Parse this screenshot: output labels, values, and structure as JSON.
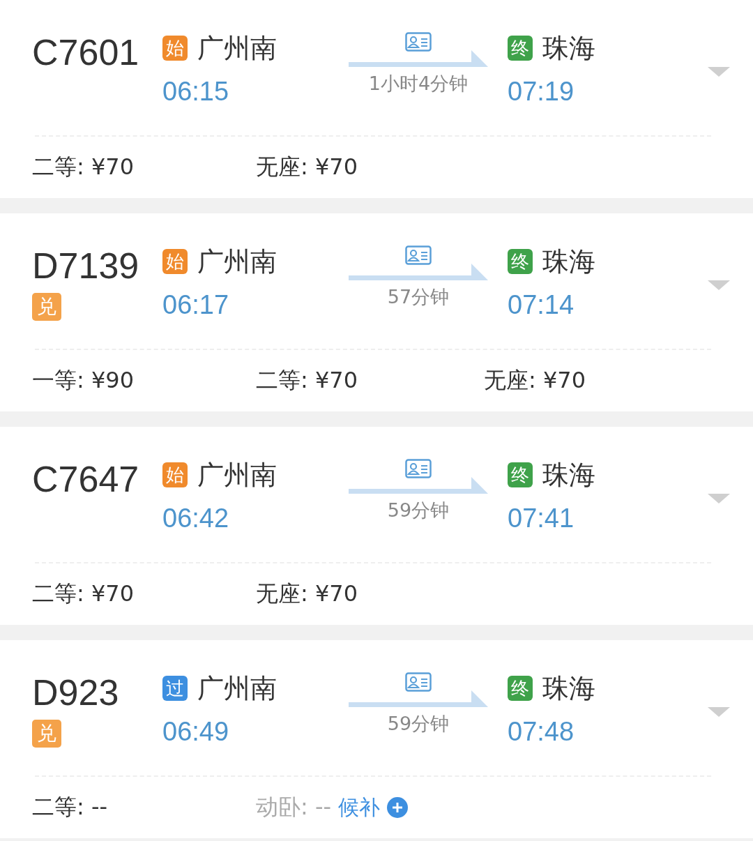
{
  "trains": [
    {
      "number": "C7601",
      "from": {
        "badge": "始",
        "kind": "start",
        "station": "广州南",
        "time": "06:15"
      },
      "duration": "1小时4分钟",
      "to": {
        "badge": "终",
        "kind": "end",
        "station": "珠海",
        "time": "07:19"
      },
      "seats": [
        {
          "label": "二等: ¥70",
          "disabled": false
        },
        {
          "label": "无座: ¥70",
          "disabled": false
        }
      ]
    },
    {
      "number": "D7139",
      "exchange": "兑",
      "from": {
        "badge": "始",
        "kind": "start",
        "station": "广州南",
        "time": "06:17"
      },
      "duration": "57分钟",
      "to": {
        "badge": "终",
        "kind": "end",
        "station": "珠海",
        "time": "07:14"
      },
      "seats": [
        {
          "label": "一等: ¥90",
          "disabled": false
        },
        {
          "label": "二等: ¥70",
          "disabled": false
        },
        {
          "label": "无座: ¥70",
          "disabled": false
        }
      ]
    },
    {
      "number": "C7647",
      "from": {
        "badge": "始",
        "kind": "start",
        "station": "广州南",
        "time": "06:42"
      },
      "duration": "59分钟",
      "to": {
        "badge": "终",
        "kind": "end",
        "station": "珠海",
        "time": "07:41"
      },
      "seats": [
        {
          "label": "二等: ¥70",
          "disabled": false
        },
        {
          "label": "无座: ¥70",
          "disabled": false
        }
      ]
    },
    {
      "number": "D923",
      "exchange": "兑",
      "from": {
        "badge": "过",
        "kind": "pass",
        "station": "广州南",
        "time": "06:49"
      },
      "duration": "59分钟",
      "to": {
        "badge": "终",
        "kind": "end",
        "station": "珠海",
        "time": "07:48"
      },
      "seats": [
        {
          "label": "二等: --",
          "disabled": false
        },
        {
          "label": "动卧: --",
          "disabled": true,
          "waitlist": "候补"
        }
      ]
    }
  ]
}
